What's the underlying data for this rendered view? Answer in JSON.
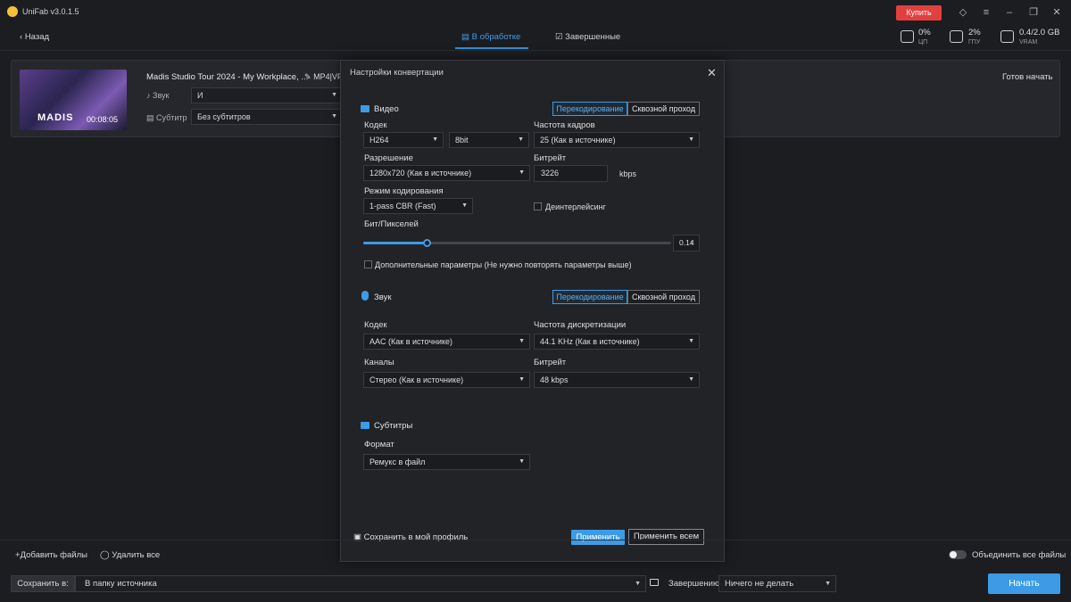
{
  "app": {
    "title": "UniFab v3.0.1.5",
    "buy_label": "Купить"
  },
  "header": {
    "back_label": "Назад",
    "tabs": [
      {
        "label": "В обработке",
        "active": true
      },
      {
        "label": "Завершенные",
        "active": false
      }
    ],
    "stats": [
      {
        "icon": "cpu-icon",
        "value": "0%",
        "label": "ЦП"
      },
      {
        "icon": "gpu-icon",
        "value": "2%",
        "label": "ГПУ"
      },
      {
        "icon": "vram-icon",
        "value": "0.4/2.0 GB",
        "label": "VRAM"
      }
    ]
  },
  "file": {
    "title": "Madis Studio Tour 2024 - My Workplace, ...",
    "format": "MP4|VF",
    "thumb_brand": "MADIS",
    "thumb_time": "00:08:05",
    "audio_label": "Звук",
    "audio_value": "И",
    "subtitle_label": "Субтитр",
    "subtitle_value": "Без субтитров",
    "status": "Готов начать"
  },
  "dialog": {
    "title": "Настройки конвертации",
    "video": {
      "title": "Видео",
      "mode_transcode": "Перекодирование",
      "mode_passthrough": "Сквозной проход",
      "codec_label": "Кодек",
      "codec": "H264",
      "bitdepth": "8bit",
      "framerate_label": "Частота кадров",
      "framerate": "25 (Как в источнике)",
      "resolution_label": "Разрешение",
      "resolution": "1280x720 (Как в источнике)",
      "bitrate_label": "Битрейт",
      "bitrate": "3226",
      "bitrate_unit": "kbps",
      "encode_mode_label": "Режим кодирования",
      "encode_mode": "1-pass CBR (Fast)",
      "deinterlace_label": "Деинтерлейсинг",
      "bpp_label": "Бит/Пикселей",
      "bpp_value": "0.14",
      "bpp_fraction": 0.21,
      "advanced_label": "Дополнительные параметры (Не нужно повторять параметры выше)"
    },
    "audio": {
      "title": "Звук",
      "mode_transcode": "Перекодирование",
      "mode_passthrough": "Сквозной проход",
      "codec_label": "Кодек",
      "codec": "AAC (Как в источнике)",
      "samplerate_label": "Частота дискретизации",
      "samplerate": "44.1 KHz (Как в источнике)",
      "channels_label": "Каналы",
      "channels": "Стерео (Как в источнике)",
      "bitrate_label": "Битрейт",
      "bitrate": "48 kbps"
    },
    "subtitles": {
      "title": "Субтитры",
      "format_label": "Формат",
      "format": "Ремукс в файл"
    },
    "save_profile_label": "Сохранить в мой профиль",
    "apply_label": "Применить",
    "apply_all_label": "Применить всем"
  },
  "bottom": {
    "add_files": "Добавить файлы",
    "remove_all": "Удалить все",
    "merge_label": "Объединить все файлы",
    "save_to_label": "Сохранить в:",
    "save_path": "В папку источника",
    "on_complete_label": "Завершению",
    "on_complete_value": "Ничего не делать",
    "start_label": "Начать"
  },
  "colors": {
    "accent": "#3d9be6",
    "buy": "#e2403f",
    "background": "#1c1d21"
  }
}
